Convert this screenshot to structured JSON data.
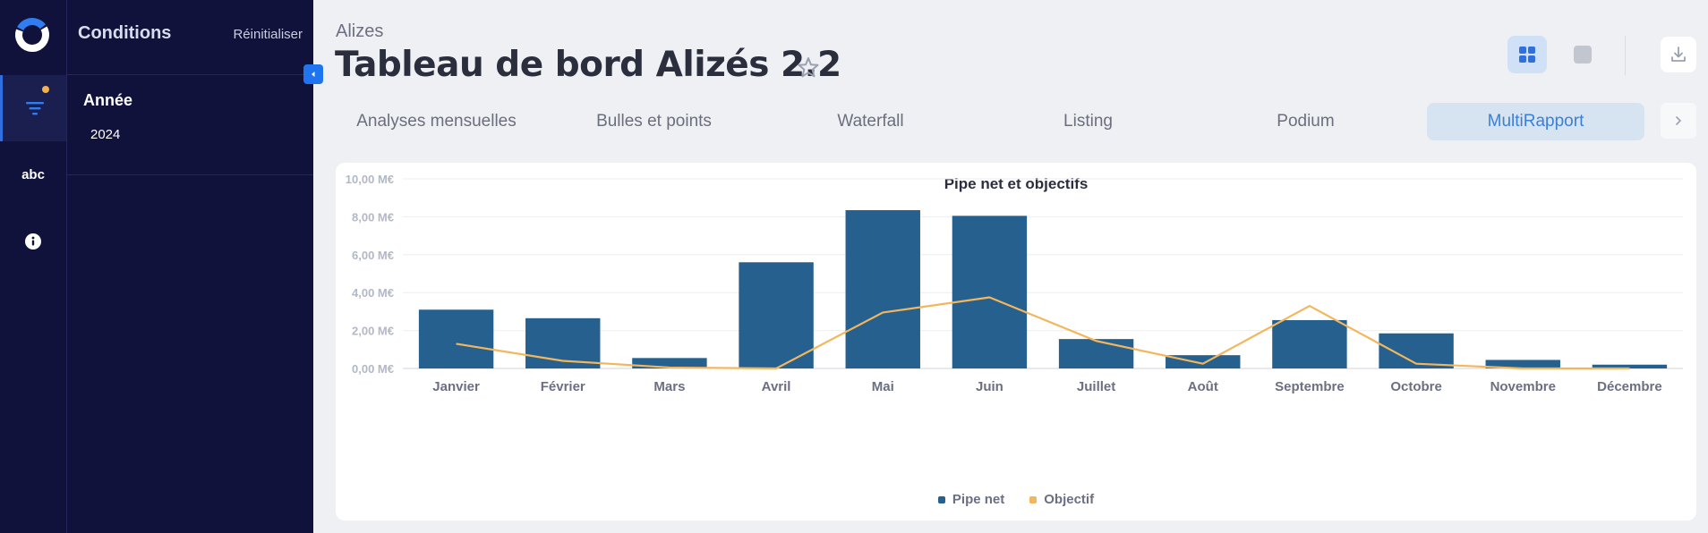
{
  "app": {
    "nav": [
      {
        "icon": "filter-icon",
        "active": true,
        "badge_color": "#f2b24d"
      },
      {
        "label": "abc"
      },
      {
        "icon": "info-icon"
      }
    ]
  },
  "panel": {
    "title": "Conditions",
    "reset_label": "Réinitialiser",
    "conditions": [
      {
        "label": "Année",
        "value": "2024"
      }
    ]
  },
  "header": {
    "breadcrumb": "Alizes",
    "title": "Tableau de bord Alizés 2.2",
    "favorite": false
  },
  "tabs": [
    {
      "label": "Analyses mensuelles",
      "active": false
    },
    {
      "label": "Bulles et points",
      "active": false
    },
    {
      "label": "Waterfall",
      "active": false
    },
    {
      "label": "Listing",
      "active": false
    },
    {
      "label": "Podium",
      "active": false
    },
    {
      "label": "MultiRapport",
      "active": true
    }
  ],
  "colors": {
    "accent": "#1f74f0",
    "bar": "#25608f",
    "line": "#f3b65c",
    "sidebar": "#10123b"
  },
  "chart_data": {
    "type": "bar",
    "title": "Pipe net et objectifs",
    "categories": [
      "Janvier",
      "Février",
      "Mars",
      "Avril",
      "Mai",
      "Juin",
      "Juillet",
      "Août",
      "Septembre",
      "Octobre",
      "Novembre",
      "Décembre"
    ],
    "series": [
      {
        "name": "Pipe net",
        "type": "bar",
        "color": "#25608f",
        "values": [
          3.1,
          2.65,
          0.55,
          5.6,
          8.35,
          8.05,
          1.55,
          0.7,
          2.55,
          1.85,
          0.45,
          0.2
        ]
      },
      {
        "name": "Objectif",
        "type": "line",
        "color": "#f3b65c",
        "values": [
          1.3,
          0.4,
          0.05,
          0.0,
          2.95,
          3.75,
          1.45,
          0.25,
          3.3,
          0.25,
          0.0,
          0.0
        ]
      }
    ],
    "ylim": [
      0,
      10
    ],
    "yticks": [
      "0,00 M€",
      "2,00 M€",
      "4,00 M€",
      "6,00 M€",
      "8,00 M€",
      "10,00 M€"
    ],
    "grid": true,
    "legend_position": "bottom"
  }
}
